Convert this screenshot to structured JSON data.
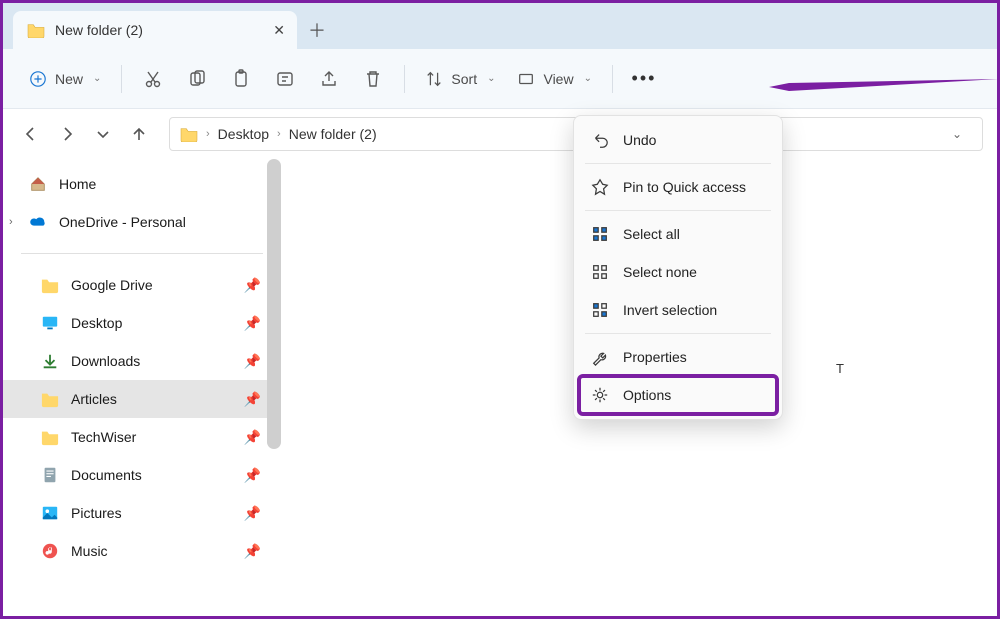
{
  "tab": {
    "title": "New folder (2)"
  },
  "toolbar": {
    "new_label": "New",
    "sort_label": "Sort",
    "view_label": "View"
  },
  "breadcrumb": {
    "parent": "Desktop",
    "current": "New folder (2)"
  },
  "sidebar": {
    "home": "Home",
    "onedrive": "OneDrive - Personal",
    "items": [
      {
        "label": "Google Drive"
      },
      {
        "label": "Desktop"
      },
      {
        "label": "Downloads"
      },
      {
        "label": "Articles"
      },
      {
        "label": "TechWiser"
      },
      {
        "label": "Documents"
      },
      {
        "label": "Pictures"
      },
      {
        "label": "Music"
      }
    ]
  },
  "context_menu": {
    "undo": "Undo",
    "pin": "Pin to Quick access",
    "select_all": "Select all",
    "select_none": "Select none",
    "invert": "Invert selection",
    "properties": "Properties",
    "options": "Options"
  },
  "content": {
    "truncated": "T"
  }
}
